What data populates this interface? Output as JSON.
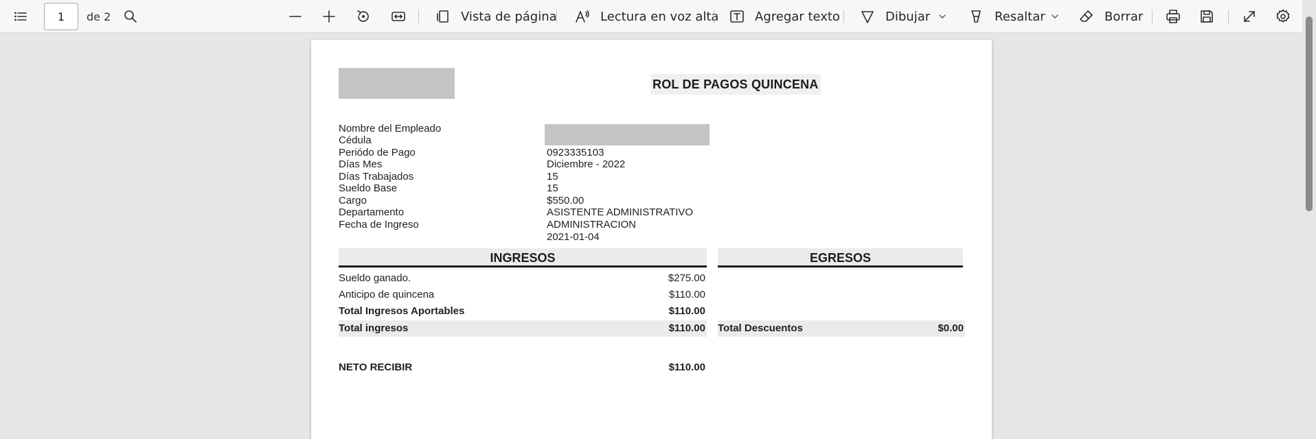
{
  "toolbar": {
    "page_number": "1",
    "page_of": "de 2",
    "page_view_label": "Vista de página",
    "read_aloud_label": "Lectura en voz alta",
    "add_text_label": "Agregar texto",
    "draw_label": "Dibujar",
    "highlight_label": "Resaltar",
    "erase_label": "Borrar"
  },
  "document": {
    "title": "ROL DE PAGOS QUINCENA",
    "field_labels": [
      "Nombre del Empleado",
      "Cédula",
      "Periódo de Pago",
      "Días Mes",
      "Días Trabajados",
      "Sueldo Base",
      "Cargo",
      "Departamento",
      "Fecha de Ingreso"
    ],
    "field_values": [
      "0923335103",
      "Diciembre - 2022",
      "15",
      "15",
      "$550.00",
      "ASISTENTE ADMINISTRATIVO",
      "ADMINISTRACION",
      "2021-01-04"
    ],
    "ingresos_header": "INGRESOS",
    "egresos_header": "EGRESOS",
    "ingresos_rows": [
      {
        "label": "Sueldo ganado.",
        "value": "$275.00"
      },
      {
        "label": "Anticipo de quincena",
        "value": "$110.00"
      },
      {
        "label": "Total Ingresos Aportables",
        "value": "$110.00"
      },
      {
        "label": "Total ingresos",
        "value": "$110.00"
      }
    ],
    "total_descuentos_label": "Total Descuentos",
    "total_descuentos_value": "$0.00",
    "neto_label": "NETO RECIBIR",
    "neto_value": "$110.00"
  }
}
